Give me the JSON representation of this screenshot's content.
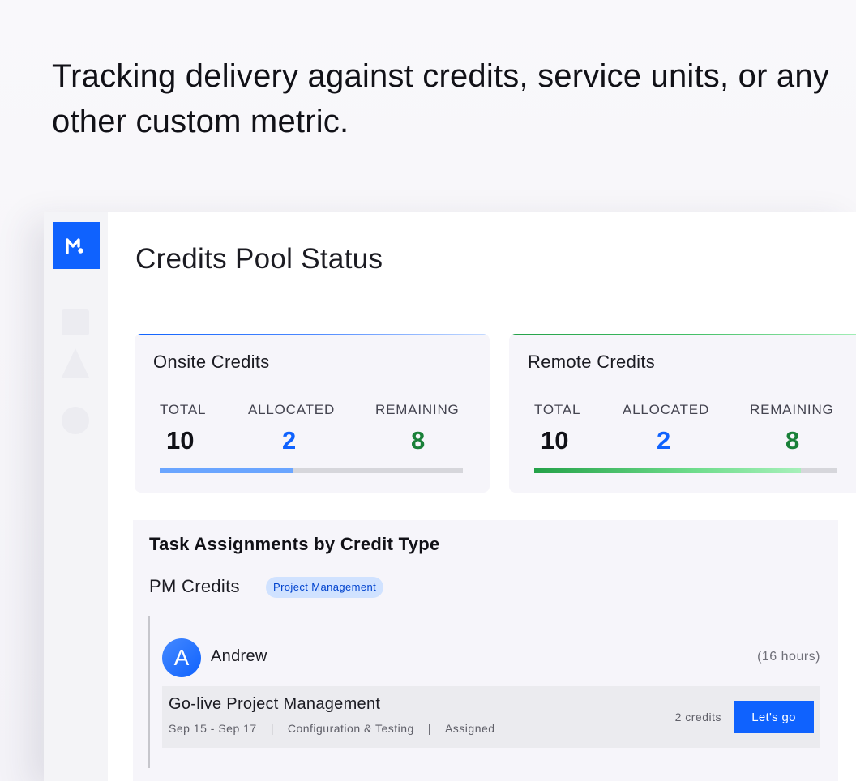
{
  "headline": "Tracking delivery against credits, service units, or any other custom metric.",
  "colors": {
    "accent": "#0f62fe",
    "success": "#198038",
    "tag_bg": "#d0e2ff"
  },
  "sidebar": {
    "logo": "M",
    "icons": [
      "square-icon",
      "triangle-icon",
      "circle-icon"
    ]
  },
  "page": {
    "title": "Credits Pool Status"
  },
  "cards": [
    {
      "title": "Onsite Credits",
      "total_label": "TOTAL",
      "total": "10",
      "allocated_label": "ALLOCATED",
      "allocated": "2",
      "remaining_label": "REMAINING",
      "remaining": "8",
      "progress": 0.44
    },
    {
      "title": "Remote Credits",
      "total_label": "TOTAL",
      "total": "10",
      "allocated_label": "ALLOCATED",
      "allocated": "2",
      "remaining_label": "REMAINING",
      "remaining": "8",
      "progress": 0.88
    }
  ],
  "tasks": {
    "title": "Task Assignments by Credit Type",
    "group": {
      "title": "PM Credits",
      "tag": "Project Management",
      "assignee": {
        "initial": "A",
        "name": "Andrew",
        "hours": "(16 hours)"
      },
      "task": {
        "name": "Go-live Project Management",
        "dates": "Sep 15 - Sep 17",
        "phase": "Configuration & Testing",
        "status": "Assigned",
        "credits": "2 credits",
        "action": "Let's go"
      }
    }
  }
}
